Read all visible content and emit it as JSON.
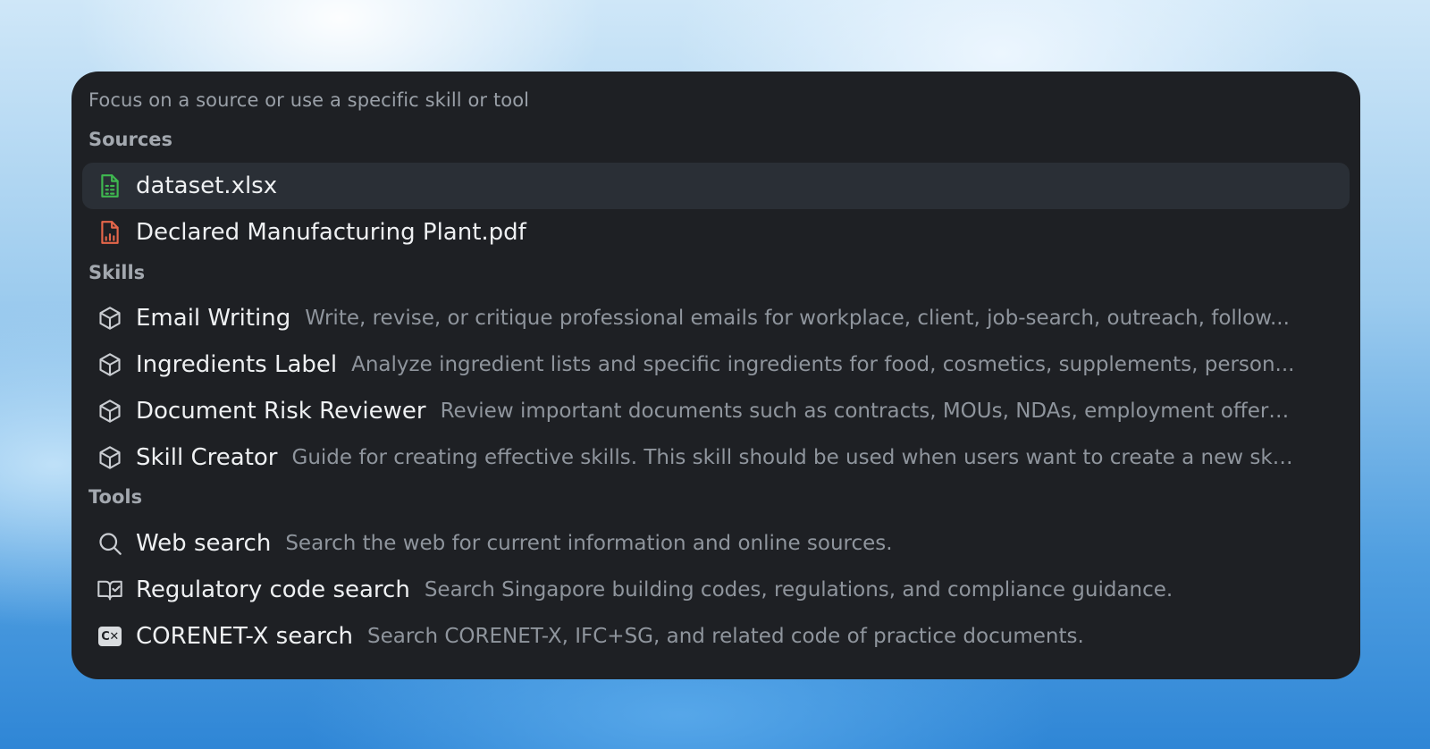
{
  "hint": "Focus on a source or use a specific skill or tool",
  "sections": {
    "sources": {
      "title": "Sources",
      "items": [
        {
          "label": "dataset.xlsx",
          "icon": "spreadsheet-file-icon",
          "color": "#3fb950"
        },
        {
          "label": "Declared Manufacturing Plant.pdf",
          "icon": "pdf-chart-file-icon",
          "color": "#e5664a"
        }
      ]
    },
    "skills": {
      "title": "Skills",
      "items": [
        {
          "label": "Email Writing",
          "desc": "Write, revise, or critique professional emails for workplace, client, job-search, outreach, follow...",
          "icon": "cube-icon"
        },
        {
          "label": "Ingredients Label",
          "desc": "Analyze ingredient lists and specific ingredients for food, cosmetics, supplements, person...",
          "icon": "cube-icon"
        },
        {
          "label": "Document Risk Reviewer",
          "desc": "Review important documents such as contracts, MOUs, NDAs, employment offers,...",
          "icon": "cube-icon"
        },
        {
          "label": "Skill Creator",
          "desc": "Guide for creating effective skills. This skill should be used when users want to create a new ski...",
          "icon": "cube-icon"
        }
      ]
    },
    "tools": {
      "title": "Tools",
      "items": [
        {
          "label": "Web search",
          "desc": "Search the web for current information and online sources.",
          "icon": "search-icon"
        },
        {
          "label": "Regulatory code search",
          "desc": "Search Singapore building codes, regulations, and compliance guidance.",
          "icon": "book-check-icon"
        },
        {
          "label": "CORENET-X search",
          "desc": "Search CORENET-X, IFC+SG, and related code of practice documents.",
          "icon": "corenet-x-icon",
          "badge": "C✕"
        }
      ]
    }
  }
}
